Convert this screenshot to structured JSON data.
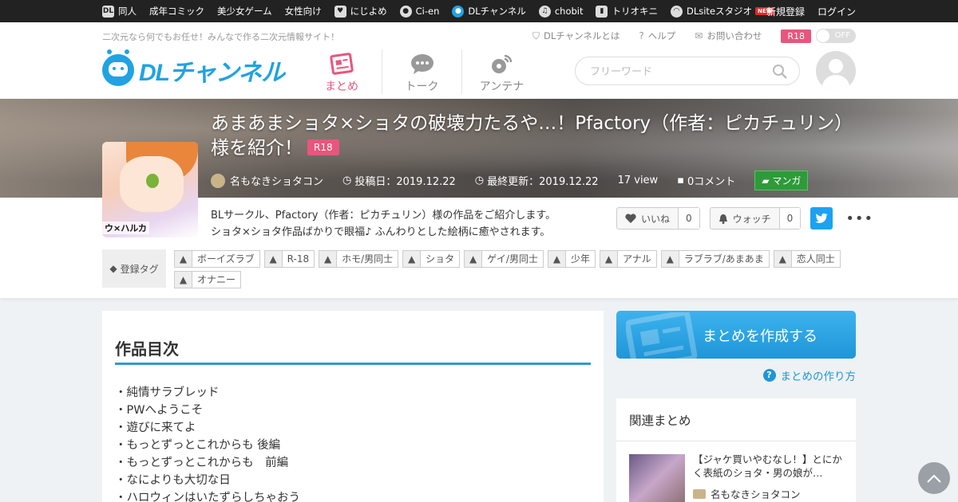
{
  "topnav": {
    "items": [
      {
        "label": "同人",
        "icon": "dl-doujin-icon"
      },
      {
        "label": "成年コミック",
        "icon": ""
      },
      {
        "label": "美少女ゲーム",
        "icon": ""
      },
      {
        "label": "女性向け",
        "icon": ""
      },
      {
        "label": "にじよめ",
        "icon": "nijiyome-icon"
      },
      {
        "label": "Ci-en",
        "icon": "cien-icon"
      },
      {
        "label": "DLチャンネル",
        "icon": "dlchannel-icon"
      },
      {
        "label": "chobit",
        "icon": "chobit-icon"
      },
      {
        "label": "トリオキニ",
        "icon": "triokini-icon"
      },
      {
        "label": "DLsiteスタジオ",
        "icon": "dlsite-studio-icon",
        "badge": "NEW"
      }
    ],
    "register": "新規登録",
    "login": "ログイン"
  },
  "header": {
    "tagline": "二次元なら何でもお任せ！みんなで作る二次元情報サイト！",
    "links": [
      "DLチャンネルとは",
      "ヘルプ",
      "お問い合わせ"
    ],
    "r18_label": "R18",
    "toggle_label": "OFF",
    "logo_text": "DLチャンネル",
    "tabs": [
      "まとめ",
      "トーク",
      "アンテナ"
    ],
    "search_placeholder": "フリーワード"
  },
  "article": {
    "title": "あまあまショタ×ショタの破壊力たるや…！Pfactory（作者：ピカチュリン）様を紹介！",
    "rating_badge": "R18",
    "thumbnail_caption": "ウ×ハルカ",
    "author": "名もなきショタコン",
    "posted": "投稿日：2019.12.22",
    "updated": "最終更新：2019.12.22",
    "views": "17 view",
    "comments": "0コメント",
    "category": "マンガ",
    "description_line1": "BLサークル、Pfactory（作者：ピカチュリン）様の作品をご紹介します。",
    "description_line2": "ショタ×ショタ作品ばかりで眼福♪ ふんわりとした絵柄に癒やされます。",
    "like_label": "いいね",
    "like_count": "0",
    "watch_label": "ウォッチ",
    "watch_count": "0",
    "tag_heading": "登録タグ",
    "tags": [
      "ボーイズラブ",
      "R-18",
      "ホモ/男同士",
      "ショタ",
      "ゲイ/男同士",
      "少年",
      "アナル",
      "ラブラブ/あまあま",
      "恋人同士",
      "オナニー"
    ]
  },
  "content": {
    "heading": "作品目次",
    "items": [
      "・純情サラブレッド",
      "・PWへようこそ",
      "・遊びに来てよ",
      "・もっとずっとこれからも 後編",
      "・もっとずっとこれからも　前編",
      "・なによりも大切な日",
      "・ハロウィンはいたずらしちゃおう"
    ]
  },
  "sidebar": {
    "create_label": "まとめを作成する",
    "howto_label": "まとめの作り方",
    "related_heading": "関連まとめ",
    "related_title": "【ジャケ買いやむなし！】とにかく表紙のショタ・男の娘が…",
    "related_author": "名もなきショタコン"
  },
  "colors": {
    "accent_blue": "#1f96d8",
    "accent_pink": "#e8567d",
    "category_green": "#2e9a3a",
    "twitter": "#1da1f2"
  }
}
